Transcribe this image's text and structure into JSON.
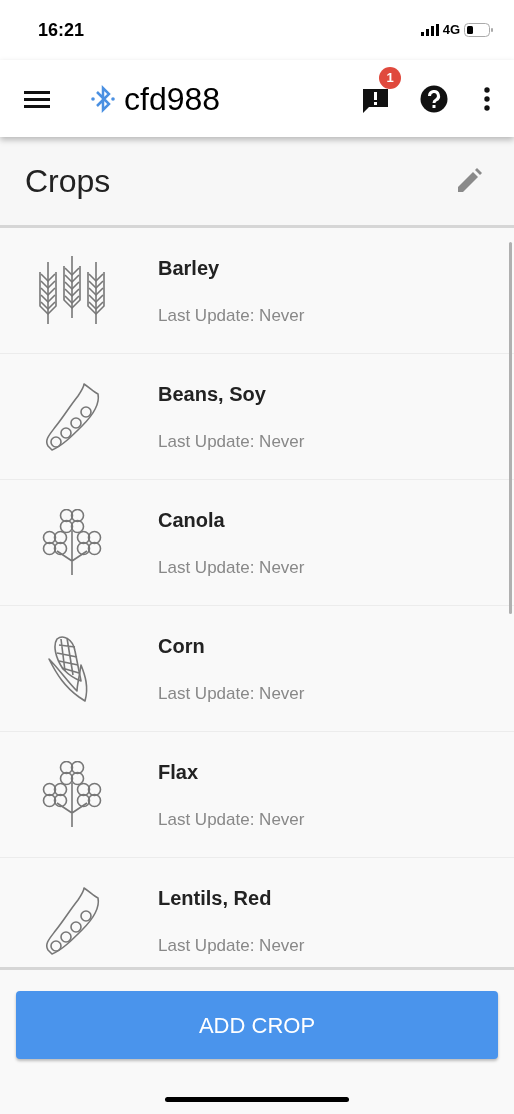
{
  "status_bar": {
    "time": "16:21",
    "network": "4G"
  },
  "app_bar": {
    "device": "cfd988",
    "alert_count": "1"
  },
  "header": {
    "title": "Crops"
  },
  "crops": [
    {
      "name": "Barley",
      "kind": "grain",
      "last_update": "Last Update: Never"
    },
    {
      "name": "Beans, Soy",
      "kind": "pod",
      "last_update": "Last Update: Never"
    },
    {
      "name": "Canola",
      "kind": "flower",
      "last_update": "Last Update: Never"
    },
    {
      "name": "Corn",
      "kind": "corn",
      "last_update": "Last Update: Never"
    },
    {
      "name": "Flax",
      "kind": "flower",
      "last_update": "Last Update: Never"
    },
    {
      "name": "Lentils, Red",
      "kind": "pod",
      "last_update": "Last Update: Never"
    }
  ],
  "add_button": "ADD CROP"
}
